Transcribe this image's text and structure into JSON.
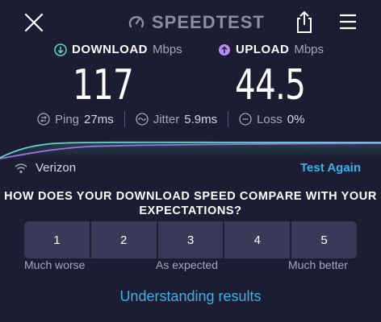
{
  "header": {
    "logo_text": "SPEEDTEST",
    "close_icon": "close-icon",
    "share_icon": "share-icon",
    "menu_icon": "menu-icon"
  },
  "download": {
    "label": "DOWNLOAD",
    "unit": "Mbps",
    "value": "117",
    "icon": "download-arrow-icon",
    "color": "#5fd6c8"
  },
  "upload": {
    "label": "UPLOAD",
    "unit": "Mbps",
    "value": "44.5",
    "icon": "upload-arrow-icon",
    "color": "#b58cf5"
  },
  "stats": {
    "ping": {
      "label": "Ping",
      "value": "27ms"
    },
    "jitter": {
      "label": "Jitter",
      "value": "5.9ms"
    },
    "loss": {
      "label": "Loss",
      "value": "0%"
    }
  },
  "provider": {
    "name": "Verizon",
    "icon": "wifi-icon"
  },
  "test_again_label": "Test Again",
  "question": "HOW DOES YOUR DOWNLOAD SPEED COMPARE WITH YOUR EXPECTATIONS?",
  "rating": {
    "options": [
      "1",
      "2",
      "3",
      "4",
      "5"
    ],
    "scale_left": "Much worse",
    "scale_mid": "As expected",
    "scale_right": "Much better"
  },
  "understanding_results_label": "Understanding results",
  "colors": {
    "background": "#1c1d33",
    "accent": "#39b2ea",
    "button": "#383a57"
  }
}
